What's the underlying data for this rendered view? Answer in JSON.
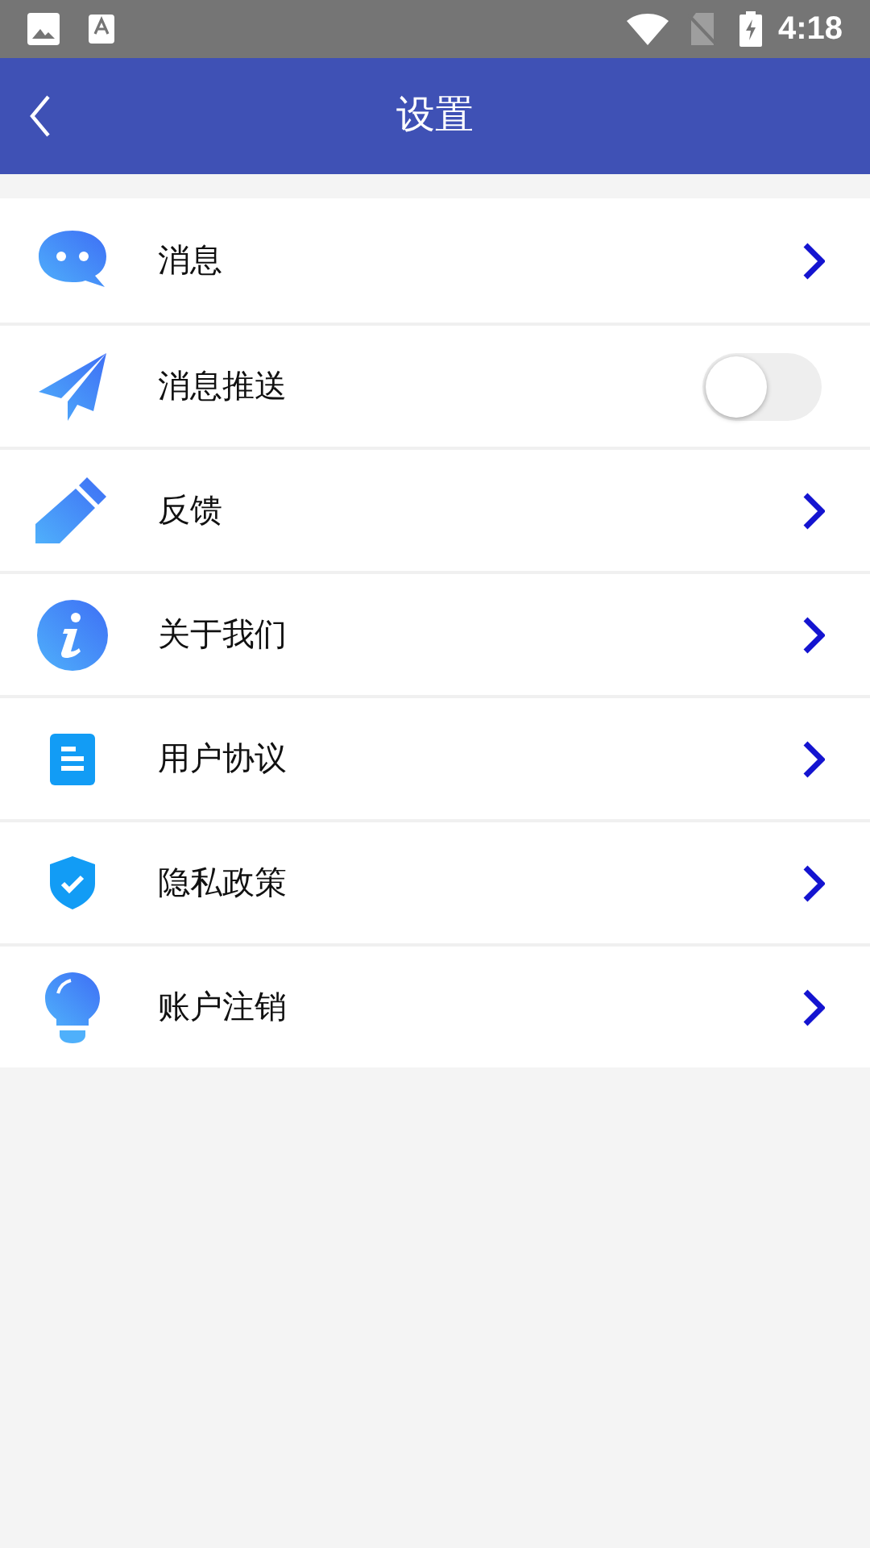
{
  "status_bar": {
    "time": "4:18"
  },
  "header": {
    "title": "设置"
  },
  "items": [
    {
      "kind": "link",
      "label": "消息"
    },
    {
      "kind": "toggle",
      "label": "消息推送",
      "on": false
    },
    {
      "kind": "link",
      "label": "反馈"
    },
    {
      "kind": "link",
      "label": "关于我们"
    },
    {
      "kind": "link",
      "label": "用户协议"
    },
    {
      "kind": "link",
      "label": "隐私政策"
    },
    {
      "kind": "link",
      "label": "账户注销"
    }
  ]
}
